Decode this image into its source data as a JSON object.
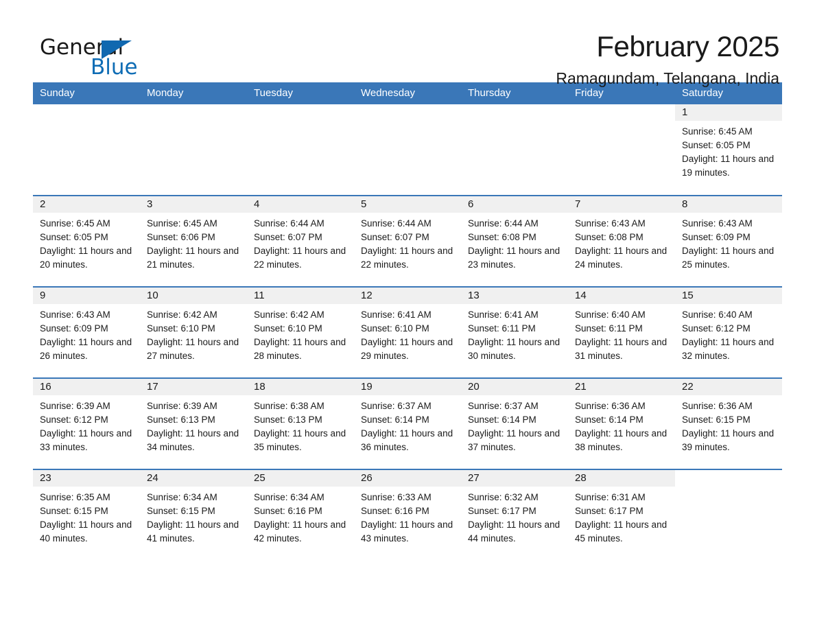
{
  "brand": {
    "name_part1": "General",
    "name_part2": "Blue",
    "triangle_color": "#1068b0",
    "blue_color": "#0f6db5"
  },
  "header": {
    "month_title": "February 2025",
    "location": "Ramagundam, Telangana, India"
  },
  "theme": {
    "header_bg": "#3a77b8",
    "daynum_band_bg": "#f0f0f0",
    "rule_color": "#3a77b8",
    "text_color": "#1a1a1a"
  },
  "weekday_headers": [
    "Sunday",
    "Monday",
    "Tuesday",
    "Wednesday",
    "Thursday",
    "Friday",
    "Saturday"
  ],
  "weeks": [
    [
      {
        "blank": true
      },
      {
        "blank": true
      },
      {
        "blank": true
      },
      {
        "blank": true
      },
      {
        "blank": true
      },
      {
        "blank": true
      },
      {
        "day": "1",
        "sunrise": "Sunrise: 6:45 AM",
        "sunset": "Sunset: 6:05 PM",
        "daylight": "Daylight: 11 hours and 19 minutes."
      }
    ],
    [
      {
        "day": "2",
        "sunrise": "Sunrise: 6:45 AM",
        "sunset": "Sunset: 6:05 PM",
        "daylight": "Daylight: 11 hours and 20 minutes."
      },
      {
        "day": "3",
        "sunrise": "Sunrise: 6:45 AM",
        "sunset": "Sunset: 6:06 PM",
        "daylight": "Daylight: 11 hours and 21 minutes."
      },
      {
        "day": "4",
        "sunrise": "Sunrise: 6:44 AM",
        "sunset": "Sunset: 6:07 PM",
        "daylight": "Daylight: 11 hours and 22 minutes."
      },
      {
        "day": "5",
        "sunrise": "Sunrise: 6:44 AM",
        "sunset": "Sunset: 6:07 PM",
        "daylight": "Daylight: 11 hours and 22 minutes."
      },
      {
        "day": "6",
        "sunrise": "Sunrise: 6:44 AM",
        "sunset": "Sunset: 6:08 PM",
        "daylight": "Daylight: 11 hours and 23 minutes."
      },
      {
        "day": "7",
        "sunrise": "Sunrise: 6:43 AM",
        "sunset": "Sunset: 6:08 PM",
        "daylight": "Daylight: 11 hours and 24 minutes."
      },
      {
        "day": "8",
        "sunrise": "Sunrise: 6:43 AM",
        "sunset": "Sunset: 6:09 PM",
        "daylight": "Daylight: 11 hours and 25 minutes."
      }
    ],
    [
      {
        "day": "9",
        "sunrise": "Sunrise: 6:43 AM",
        "sunset": "Sunset: 6:09 PM",
        "daylight": "Daylight: 11 hours and 26 minutes."
      },
      {
        "day": "10",
        "sunrise": "Sunrise: 6:42 AM",
        "sunset": "Sunset: 6:10 PM",
        "daylight": "Daylight: 11 hours and 27 minutes."
      },
      {
        "day": "11",
        "sunrise": "Sunrise: 6:42 AM",
        "sunset": "Sunset: 6:10 PM",
        "daylight": "Daylight: 11 hours and 28 minutes."
      },
      {
        "day": "12",
        "sunrise": "Sunrise: 6:41 AM",
        "sunset": "Sunset: 6:10 PM",
        "daylight": "Daylight: 11 hours and 29 minutes."
      },
      {
        "day": "13",
        "sunrise": "Sunrise: 6:41 AM",
        "sunset": "Sunset: 6:11 PM",
        "daylight": "Daylight: 11 hours and 30 minutes."
      },
      {
        "day": "14",
        "sunrise": "Sunrise: 6:40 AM",
        "sunset": "Sunset: 6:11 PM",
        "daylight": "Daylight: 11 hours and 31 minutes."
      },
      {
        "day": "15",
        "sunrise": "Sunrise: 6:40 AM",
        "sunset": "Sunset: 6:12 PM",
        "daylight": "Daylight: 11 hours and 32 minutes."
      }
    ],
    [
      {
        "day": "16",
        "sunrise": "Sunrise: 6:39 AM",
        "sunset": "Sunset: 6:12 PM",
        "daylight": "Daylight: 11 hours and 33 minutes."
      },
      {
        "day": "17",
        "sunrise": "Sunrise: 6:39 AM",
        "sunset": "Sunset: 6:13 PM",
        "daylight": "Daylight: 11 hours and 34 minutes."
      },
      {
        "day": "18",
        "sunrise": "Sunrise: 6:38 AM",
        "sunset": "Sunset: 6:13 PM",
        "daylight": "Daylight: 11 hours and 35 minutes."
      },
      {
        "day": "19",
        "sunrise": "Sunrise: 6:37 AM",
        "sunset": "Sunset: 6:14 PM",
        "daylight": "Daylight: 11 hours and 36 minutes."
      },
      {
        "day": "20",
        "sunrise": "Sunrise: 6:37 AM",
        "sunset": "Sunset: 6:14 PM",
        "daylight": "Daylight: 11 hours and 37 minutes."
      },
      {
        "day": "21",
        "sunrise": "Sunrise: 6:36 AM",
        "sunset": "Sunset: 6:14 PM",
        "daylight": "Daylight: 11 hours and 38 minutes."
      },
      {
        "day": "22",
        "sunrise": "Sunrise: 6:36 AM",
        "sunset": "Sunset: 6:15 PM",
        "daylight": "Daylight: 11 hours and 39 minutes."
      }
    ],
    [
      {
        "day": "23",
        "sunrise": "Sunrise: 6:35 AM",
        "sunset": "Sunset: 6:15 PM",
        "daylight": "Daylight: 11 hours and 40 minutes."
      },
      {
        "day": "24",
        "sunrise": "Sunrise: 6:34 AM",
        "sunset": "Sunset: 6:15 PM",
        "daylight": "Daylight: 11 hours and 41 minutes."
      },
      {
        "day": "25",
        "sunrise": "Sunrise: 6:34 AM",
        "sunset": "Sunset: 6:16 PM",
        "daylight": "Daylight: 11 hours and 42 minutes."
      },
      {
        "day": "26",
        "sunrise": "Sunrise: 6:33 AM",
        "sunset": "Sunset: 6:16 PM",
        "daylight": "Daylight: 11 hours and 43 minutes."
      },
      {
        "day": "27",
        "sunrise": "Sunrise: 6:32 AM",
        "sunset": "Sunset: 6:17 PM",
        "daylight": "Daylight: 11 hours and 44 minutes."
      },
      {
        "day": "28",
        "sunrise": "Sunrise: 6:31 AM",
        "sunset": "Sunset: 6:17 PM",
        "daylight": "Daylight: 11 hours and 45 minutes."
      },
      {
        "blank": true
      }
    ]
  ]
}
